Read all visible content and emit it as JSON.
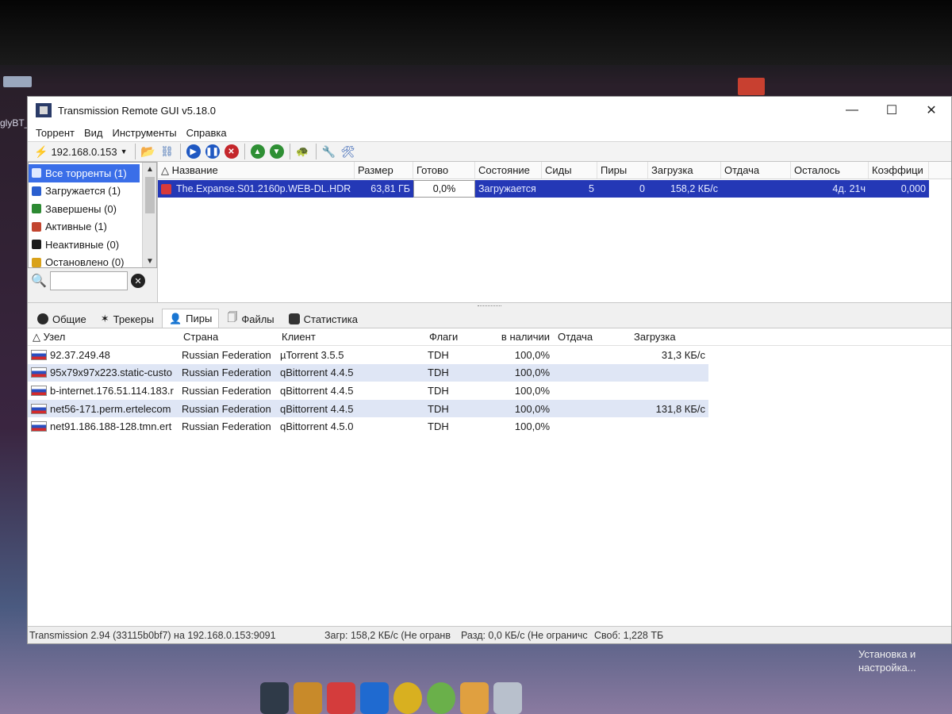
{
  "desktop": {
    "label": "glyBT_",
    "setup_label": "Установка и настройка..."
  },
  "window": {
    "title": "Transmission Remote GUI v5.18.0"
  },
  "menu": [
    "Торрент",
    "Вид",
    "Инструменты",
    "Справка"
  ],
  "toolbar": {
    "host": "192.168.0.153"
  },
  "filters": {
    "items": [
      {
        "label": "Все торренты (1)",
        "color": "#3b6fd6"
      },
      {
        "label": "Загружается (1)",
        "color": "#2a5fcf"
      },
      {
        "label": "Завершены (0)",
        "color": "#2d8a33"
      },
      {
        "label": "Активные (1)",
        "color": "#c2452f"
      },
      {
        "label": "Неактивные (0)",
        "color": "#1b1b1b"
      },
      {
        "label": "Остановлено (0)",
        "color": "#d9a21b"
      }
    ],
    "search_value": ""
  },
  "torrents": {
    "columns": [
      "△ Название",
      "Размер",
      "Готово",
      "Состояние",
      "Сиды",
      "Пиры",
      "Загрузка",
      "Отдача",
      "Осталось",
      "Коэффици"
    ],
    "rows": [
      {
        "name": "The.Expanse.S01.2160p.WEB-DL.HDR",
        "size": "63,81 ГБ",
        "done": "0,0%",
        "status": "Загружается",
        "seeds": "5",
        "peers": "0",
        "down": "158,2 КБ/с",
        "up": "",
        "eta": "4д. 21ч",
        "ratio": "0,000"
      }
    ]
  },
  "tabs": [
    "Общие",
    "Трекеры",
    "Пиры",
    "Файлы",
    "Статистика"
  ],
  "peers": {
    "columns": [
      "△ Узел",
      "Страна",
      "Клиент",
      "Флаги",
      "в наличии",
      "Отдача",
      "Загрузка"
    ],
    "rows": [
      {
        "host": "92.37.249.48",
        "country": "Russian Federation",
        "client": "µTorrent 3.5.5",
        "flags": "TDH",
        "have": "100,0%",
        "up": "",
        "down": "31,3 КБ/с"
      },
      {
        "host": "95x79x97x223.static-custo",
        "country": "Russian Federation",
        "client": "qBittorrent 4.4.5",
        "flags": "TDH",
        "have": "100,0%",
        "up": "",
        "down": ""
      },
      {
        "host": "b-internet.176.51.114.183.r",
        "country": "Russian Federation",
        "client": "qBittorrent 4.4.5",
        "flags": "TDH",
        "have": "100,0%",
        "up": "",
        "down": ""
      },
      {
        "host": "net56-171.perm.ertelecom",
        "country": "Russian Federation",
        "client": "qBittorrent 4.4.5",
        "flags": "TDH",
        "have": "100,0%",
        "up": "",
        "down": "131,8 КБ/с"
      },
      {
        "host": "net91.186.188-128.tmn.ert",
        "country": "Russian Federation",
        "client": "qBittorrent 4.5.0",
        "flags": "TDH",
        "have": "100,0%",
        "up": "",
        "down": ""
      }
    ]
  },
  "status": {
    "version": "Transmission 2.94 (33115b0bf7) на 192.168.0.153:9091",
    "download": "Загр: 158,2 КБ/с (Не огранв",
    "upload": "Разд: 0,0 КБ/с (Не ограничс",
    "free": "Своб: 1,228 ТБ"
  }
}
